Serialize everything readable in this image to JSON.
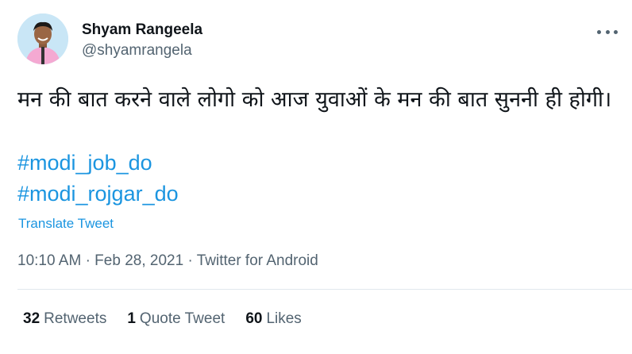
{
  "author": {
    "name": "Shyam Rangeela",
    "handle": "@shyamrangela"
  },
  "tweet": {
    "text": "मन की बात करने वाले लोगो को आज युवाओं के मन की बात सुननी ही होगी।",
    "hashtags": [
      "#modi_job_do",
      "#modi_rojgar_do"
    ],
    "translate_label": "Translate Tweet"
  },
  "meta": {
    "time": "10:10 AM",
    "date": "Feb 28, 2021",
    "source": "Twitter for Android",
    "separator": "·"
  },
  "stats": {
    "retweets_count": "32",
    "retweets_label": "Retweets",
    "quotes_count": "1",
    "quotes_label": "Quote Tweet",
    "likes_count": "60",
    "likes_label": "Likes"
  },
  "colors": {
    "link": "#1b95e0",
    "secondary": "#536471",
    "primary": "#0f1419"
  },
  "icons": {
    "avatar": "profile-photo",
    "more": "more-options-icon"
  }
}
